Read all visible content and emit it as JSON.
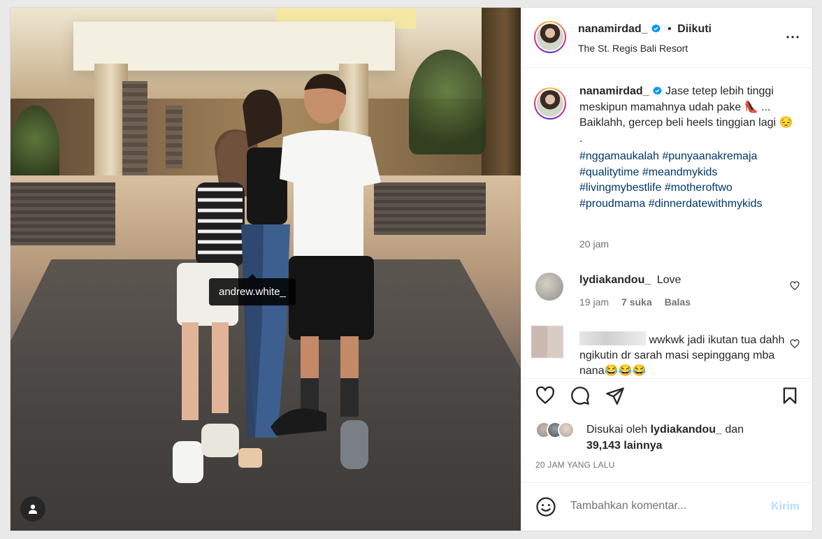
{
  "photo": {
    "tagged_user": "andrew.white_",
    "user_tag_icon": "person-icon"
  },
  "header": {
    "username": "nanamirdad_",
    "separator": "•",
    "follow_status": "Diikuti",
    "location": "The St. Regis Bali Resort",
    "more_icon": "more-horizontal-icon"
  },
  "caption": {
    "username": "nanamirdad_",
    "text_1": "Jase tetep lebih tinggi meskipun mamahnya udah pake",
    "emoji_heel": "👠",
    "text_2": "... Baiklahh, gercep beli heels tinggian lagi",
    "emoji_face": "😔",
    "dot": ".",
    "hashtags": "#nggamaukalah #punyaanakremaja #qualitytime #meandmykids #livingmybestlife #motheroftwo #proudmama #dinnerdatewithmykids",
    "time": "20 jam"
  },
  "comments": [
    {
      "username": "lydiakandou_",
      "text": "Love",
      "time": "19 jam",
      "likes": "7 suka",
      "reply": "Balas"
    },
    {
      "username": "",
      "text": "wwkwk jadi ikutan tua dahh ngikutin dr sarah masi sepinggang mba nana😂😂😂"
    }
  ],
  "actions": {
    "like_icon": "heart-icon",
    "comment_icon": "comment-icon",
    "share_icon": "send-icon",
    "save_icon": "bookmark-icon"
  },
  "likes": {
    "prefix": "Disukai oleh",
    "user": "lydiakandou_",
    "and": "dan",
    "count": "39,143 lainnya"
  },
  "posted_ago": "20 JAM YANG LALU",
  "comment_box": {
    "placeholder": "Tambahkan komentar...",
    "post_label": "Kirim",
    "emoji_icon": "smile-icon"
  },
  "colors": {
    "link": "#00376b",
    "verified": "#0095f6",
    "post_disabled": "#b2dffc",
    "secondary_text": "#737373"
  }
}
